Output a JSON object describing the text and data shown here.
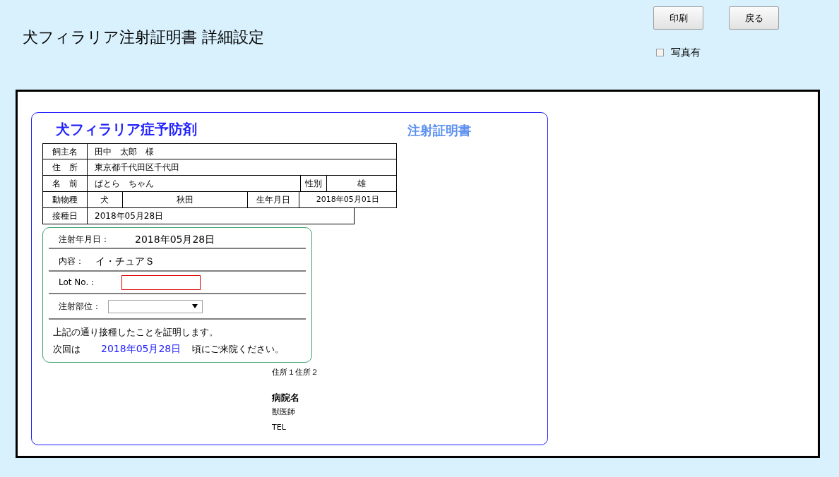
{
  "page_title": "犬フィラリア注射証明書 詳細設定",
  "buttons": [
    "印刷",
    "戻る"
  ],
  "photo_option": {
    "label": "写真有",
    "checked": false
  },
  "certificate": {
    "heading": "犬フィラリア症予防剤",
    "heading_right": "注射証明書",
    "table_rows": [
      [
        "飼主名",
        "田中　太郎　様"
      ],
      [
        "住　所",
        "東京都千代田区千代田"
      ],
      [
        "名　前",
        "ぱとら　ちゃん",
        "性別",
        "雄"
      ],
      [
        "動物種",
        "犬",
        "秋田",
        "生年月日",
        "2018年05月01日"
      ],
      [
        "接種日",
        "2018年05月28日"
      ]
    ],
    "injection": {
      "date_label": "注射年月日：",
      "date": "2018年05月28日",
      "content_label": "内容：",
      "content": "イ・チュアＳ",
      "lot_label": "Lot No.：",
      "site_label": "注射部位：",
      "statement": "上記の通り接種したことを証明します。",
      "next_prefix": "次回は",
      "next_date": "2018年05月28日",
      "next_suffix": "頃にご来院ください。"
    },
    "address": "住所１住所２",
    "hospital": "病院名",
    "vet": "獣医師",
    "tel": "TEL"
  }
}
